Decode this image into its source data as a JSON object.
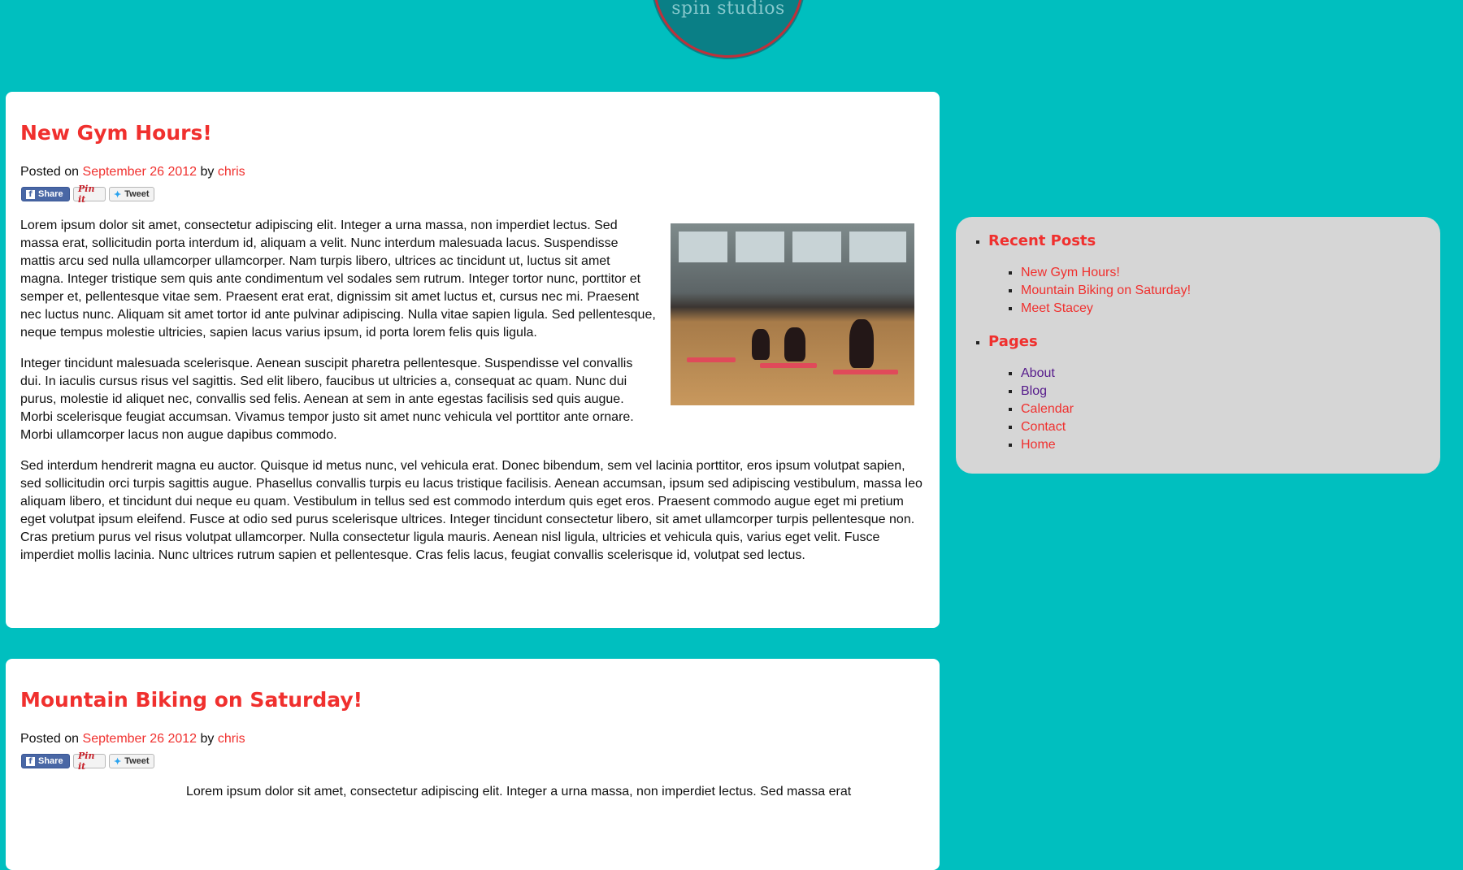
{
  "site": {
    "logo_text": "spin studios"
  },
  "posts": [
    {
      "title": "New Gym Hours!",
      "meta": {
        "posted_on": "Posted on",
        "date": "September 26 2012",
        "by": "by",
        "author": "chris"
      },
      "share": {
        "facebook": "Share",
        "pinterest": "Pin it",
        "twitter": "Tweet"
      },
      "image_alt": "Group fitness class in gym studio",
      "paragraphs": [
        "Lorem ipsum dolor sit amet, consectetur adipiscing elit. Integer a urna massa, non imperdiet lectus. Sed massa erat, sollicitudin porta interdum id, aliquam a velit. Nunc interdum malesuada lacus. Suspendisse mattis arcu sed nulla ullamcorper ullamcorper. Nam turpis libero, ultrices ac tincidunt ut, luctus sit amet magna. Integer tristique sem quis ante condimentum vel sodales sem rutrum. Integer tortor nunc, porttitor et semper et, pellentesque vitae sem. Praesent erat erat, dignissim sit amet luctus et, cursus nec mi. Praesent nec luctus nunc. Aliquam sit amet tortor id ante pulvinar adipiscing. Nulla vitae sapien ligula. Sed pellentesque, neque tempus molestie ultricies, sapien lacus varius ipsum, id porta lorem felis quis ligula.",
        "Integer tincidunt malesuada scelerisque. Aenean suscipit pharetra pellentesque. Suspendisse vel convallis dui. In iaculis cursus risus vel sagittis. Sed elit libero, faucibus ut ultricies a, consequat ac quam. Nunc dui purus, molestie id aliquet nec, convallis sed felis. Aenean at sem in ante egestas facilisis sed quis augue. Morbi scelerisque feugiat accumsan. Vivamus tempor justo sit amet nunc vehicula vel porttitor ante ornare. Morbi ullamcorper lacus non augue dapibus commodo.",
        "Sed interdum hendrerit magna eu auctor. Quisque id metus nunc, vel vehicula erat. Donec bibendum, sem vel lacinia porttitor, eros ipsum volutpat sapien, sed sollicitudin orci turpis sagittis augue. Phasellus convallis turpis eu lacus tristique facilisis. Aenean accumsan, ipsum sed adipiscing vestibulum, massa leo aliquam libero, et tincidunt dui neque eu quam. Vestibulum in tellus sed est commodo interdum quis eget eros. Praesent commodo augue eget mi pretium eget volutpat ipsum eleifend. Fusce at odio sed purus scelerisque ultrices. Integer tincidunt consectetur libero, sit amet ullamcorper turpis pellentesque non. Cras pretium purus vel risus volutpat ullamcorper. Nulla consectetur ligula mauris. Aenean nisl ligula, ultricies et vehicula quis, varius eget velit. Fusce imperdiet mollis lacinia. Nunc ultrices rutrum sapien et pellentesque. Cras felis lacus, feugiat convallis scelerisque id, volutpat sed lectus."
      ]
    },
    {
      "title": "Mountain Biking on Saturday!",
      "meta": {
        "posted_on": "Posted on",
        "date": "September 26 2012",
        "by": "by",
        "author": "chris"
      },
      "share": {
        "facebook": "Share",
        "pinterest": "Pin it",
        "twitter": "Tweet"
      },
      "paragraphs": [
        "Lorem ipsum dolor sit amet, consectetur adipiscing elit. Integer a urna massa, non imperdiet lectus. Sed massa erat"
      ]
    }
  ],
  "sidebar": {
    "recent_posts": {
      "title": "Recent Posts",
      "items": [
        "New Gym Hours!",
        "Mountain Biking on Saturday!",
        "Meet Stacey"
      ]
    },
    "pages": {
      "title": "Pages",
      "items": [
        "About",
        "Blog",
        "Calendar",
        "Contact",
        "Home"
      ]
    }
  },
  "colors": {
    "background": "#00bfbf",
    "accent": "#f0302e",
    "visited_link": "#551a8b",
    "sidebar_bg": "#d6d6d6"
  }
}
